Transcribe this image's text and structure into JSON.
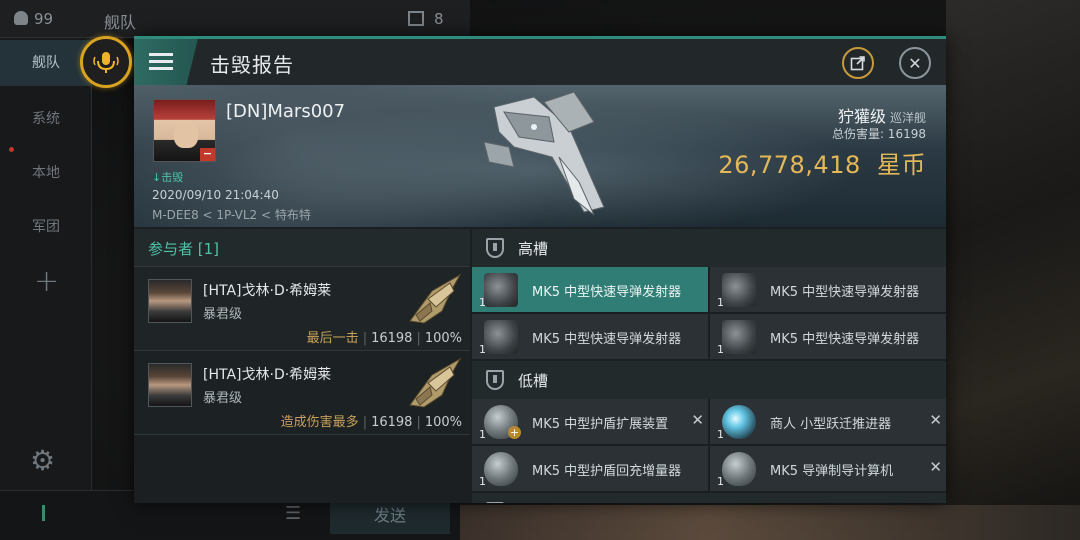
{
  "background": {
    "member_count": "99",
    "tab_title": "舰队",
    "message_count": "8",
    "nav": [
      "舰队",
      "系统",
      "本地",
      "军团"
    ],
    "send_label": "发送"
  },
  "panel": {
    "title": "击毁报告"
  },
  "victim": {
    "name": "[DN]Mars007",
    "kill_tag": "击毁",
    "datetime": "2020/09/10 21:04:40",
    "location": "M-DEE8 < 1P-VL2 < 特布特",
    "ship_name": "狞獾级",
    "ship_type": "巡洋舰",
    "total_damage_label": "总伤害量: 16198",
    "isk_value": "26,778,418",
    "isk_unit": "星币"
  },
  "participants": {
    "header": "参与者 [1]",
    "rows": [
      {
        "name": "[HTA]戈林·D·希姆莱",
        "ship_class": "暴君级",
        "role": "最后一击",
        "damage": "16198",
        "percent": "100%"
      },
      {
        "name": "[HTA]戈林·D·希姆莱",
        "ship_class": "暴君级",
        "role": "造成伤害最多",
        "damage": "16198",
        "percent": "100%"
      }
    ]
  },
  "fitting": {
    "high_slot_label": "高槽",
    "low_slot_label": "低槽",
    "high_slots": [
      {
        "name": "MK5 中型快速导弹发射器",
        "qty": "1"
      },
      {
        "name": "MK5 中型快速导弹发射器",
        "qty": "1"
      },
      {
        "name": "MK5 中型快速导弹发射器",
        "qty": "1"
      },
      {
        "name": "MK5 中型快速导弹发射器",
        "qty": "1"
      }
    ],
    "low_slots": [
      {
        "name": "MK5 中型护盾扩展装置",
        "qty": "1",
        "destroyed": "✕"
      },
      {
        "name": "商人 小型跃迁推进器",
        "qty": "1",
        "destroyed": "✕"
      },
      {
        "name": "MK5 中型护盾回充增量器",
        "qty": "1",
        "destroyed": ""
      },
      {
        "name": "MK5 导弹制导计算机",
        "qty": "1",
        "destroyed": "✕"
      }
    ]
  },
  "colors": {
    "accent": "#2f8c7c",
    "isk": "#e2b85b",
    "role": "#c7a158",
    "mic_ring": "#d9a321"
  }
}
